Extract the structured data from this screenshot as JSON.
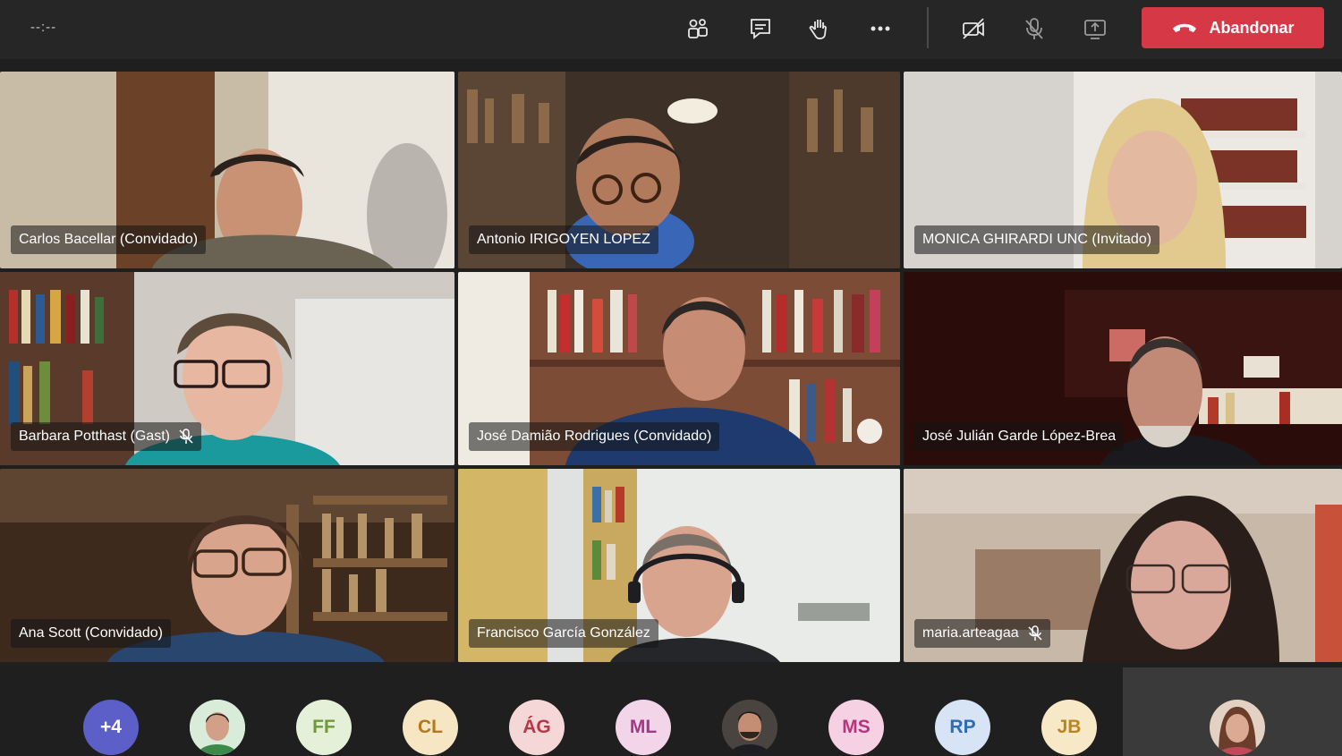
{
  "topbar": {
    "timer": "--:--",
    "buttons": [
      {
        "name": "participants-button",
        "icon": "people-icon"
      },
      {
        "name": "chat-button",
        "icon": "chat-icon"
      },
      {
        "name": "raise-hand-button",
        "icon": "hand-icon"
      },
      {
        "name": "more-actions-button",
        "icon": "more-icon"
      },
      {
        "name": "camera-toggle-button",
        "icon": "camera-off-icon"
      },
      {
        "name": "mic-toggle-button",
        "icon": "mic-off-icon"
      },
      {
        "name": "share-screen-button",
        "icon": "share-icon"
      }
    ],
    "leave_label": "Abandonar",
    "leave_color": "#d63846"
  },
  "participants": [
    {
      "name": "Carlos Bacellar (Convidado)",
      "muted": false
    },
    {
      "name": "Antonio IRIGOYEN LOPEZ",
      "muted": false
    },
    {
      "name": "MONICA GHIRARDI UNC (Invitado)",
      "muted": false
    },
    {
      "name": "Barbara Potthast (Gast)",
      "muted": true
    },
    {
      "name": "José Damião Rodrigues (Convidado)",
      "muted": false
    },
    {
      "name": "José Julián Garde López-Brea",
      "muted": false
    },
    {
      "name": "Ana Scott (Convidado)",
      "muted": false
    },
    {
      "name": "Francisco García González",
      "muted": false
    },
    {
      "name": "maria.arteagaa",
      "muted": true
    }
  ],
  "roster": [
    {
      "initials": "+4",
      "bg": "#5b5fc7",
      "fg": "#ffffff"
    },
    {
      "initials": "",
      "photo": true,
      "bg": "#d8ecd9"
    },
    {
      "initials": "FF",
      "bg": "#e4f1d8",
      "fg": "#6e9a3a"
    },
    {
      "initials": "CL",
      "bg": "#f7e6c4",
      "fg": "#b07a1e"
    },
    {
      "initials": "ÁG",
      "bg": "#f6d7d8",
      "fg": "#b23a48"
    },
    {
      "initials": "ML",
      "bg": "#f3d5ea",
      "fg": "#a33889"
    },
    {
      "initials": "",
      "photo": true,
      "bg": "#3a3a3a"
    },
    {
      "initials": "MS",
      "bg": "#f6d1e3",
      "fg": "#b5367e"
    },
    {
      "initials": "RP",
      "bg": "#d6e4f6",
      "fg": "#2f6cb5"
    },
    {
      "initials": "JB",
      "bg": "#f7e9c8",
      "fg": "#b8861d"
    }
  ]
}
